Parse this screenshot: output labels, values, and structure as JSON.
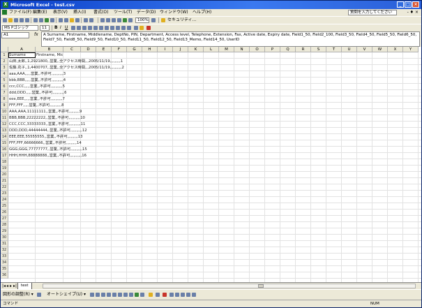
{
  "window": {
    "title": "Microsoft Excel - test.csv"
  },
  "menu": {
    "items": [
      "ファイル(F)",
      "編集(E)",
      "表示(V)",
      "挿入(I)",
      "書式(O)",
      "ツール(T)",
      "データ(D)",
      "ウィンドウ(W)",
      "ヘルプ(H)"
    ],
    "help_box": "質問を入力してください",
    "doc_controls": "- ♦ ×"
  },
  "toolbar1": {
    "zoom": "100%",
    "toolbar_label": "セキュリティ..."
  },
  "toolbar2": {
    "font": "MS Pゴシック",
    "size": "11"
  },
  "formula_bar": {
    "namebox": "A1",
    "fx": "fx",
    "content": "A Surname, Firstname, Middlename, DeptNo, PIN, Department, Access level, Telephone, Extension, Fax, Active date, Expiry date, Field1_50, Field2_100, Field3_50, Field4_50, Field5_50, Field6_50, Field7_50, Field8_50, Field9_50, Field10_50, Field11_50, Field12_50, Field13_Memo, Field14_50, UserID"
  },
  "grid": {
    "columns": [
      "A",
      "B",
      "C",
      "D",
      "E",
      "F",
      "G",
      "H",
      "I",
      "J",
      "K",
      "L",
      "M",
      "N",
      "O",
      "P",
      "Q",
      "R",
      "S",
      "T",
      "U",
      "V",
      "W",
      "X",
      "Y"
    ],
    "row_numbers": [
      "1",
      "2",
      "3",
      "4",
      "5",
      "6",
      "7",
      "8",
      "9",
      "10",
      "11",
      "12",
      "13",
      "14",
      "15",
      "16",
      "17",
      "18",
      "19",
      "20",
      "21",
      "22",
      "23",
      "24",
      "25",
      "26",
      "27",
      "28",
      "29",
      "30",
      "31",
      "32",
      "33",
      "34",
      "35",
      "36"
    ],
    "rows": [
      [
        "Surname",
        "Firstname, Middl"
      ],
      [
        "山田,太郎,,1,2921800,,営業,,全アクセス時間,,,2005/11/19,,,,,,,,,1"
      ],
      [
        "佐藤,花子,,1,4400707,,営業,,全アクセス時間,,,2005/11/19,,,,,,,,,,2"
      ],
      [
        "aaa,AAA,,,,,営業,,不許可,,,,,,,,,,3"
      ],
      [
        "bbb,BBB,,,,,営業,,不許可,,,,,,,,,,4"
      ],
      [
        "ccc,CCC,,,,,営業,,不許可,,,,,,,,,,5"
      ],
      [
        "ddd,DDD,,,,,営業,,不許可,,,,,,,,,,6"
      ],
      [
        "eee,EEE,,,,,営業,,不許可,,,,,,,,,,7"
      ],
      [
        "FFF,FFF,,,,,営業,,不許可,,,,,,,,,,8"
      ],
      [
        "AAA,AAA,11111111,,営業,,不許可,,,,,,,,,9"
      ],
      [
        "BBB,BBB,22222222,,営業,,不許可,,,,,,,,,,10"
      ],
      [
        "CCC,CCC,33333333,,営業,,不許可,,,,,,,,,,11"
      ],
      [
        "DDD,DDD,44444444,,営業,,不許可,,,,,,,,,,12"
      ],
      [
        "EEE,EEE,55555555,,営業,,不許可,,,,,,,,,13"
      ],
      [
        "FFF,FFF,66666666,,営業,,不許可,,,,,,,,,14"
      ],
      [
        "GGG,GGG,77777777,,営業,,不許可,,,,,,,,,,15"
      ],
      [
        "HHH,HHH,88888888,,営業,,不許可,,,,,,,,,,16"
      ]
    ]
  },
  "sheet_tab": "test",
  "drawing_toolbar": {
    "draw_label": "図形の調整(R) ▾",
    "autoshapes_label": "オートシェイプ(U) ▾"
  },
  "status": {
    "left": "コマンド",
    "right": "NUM"
  }
}
